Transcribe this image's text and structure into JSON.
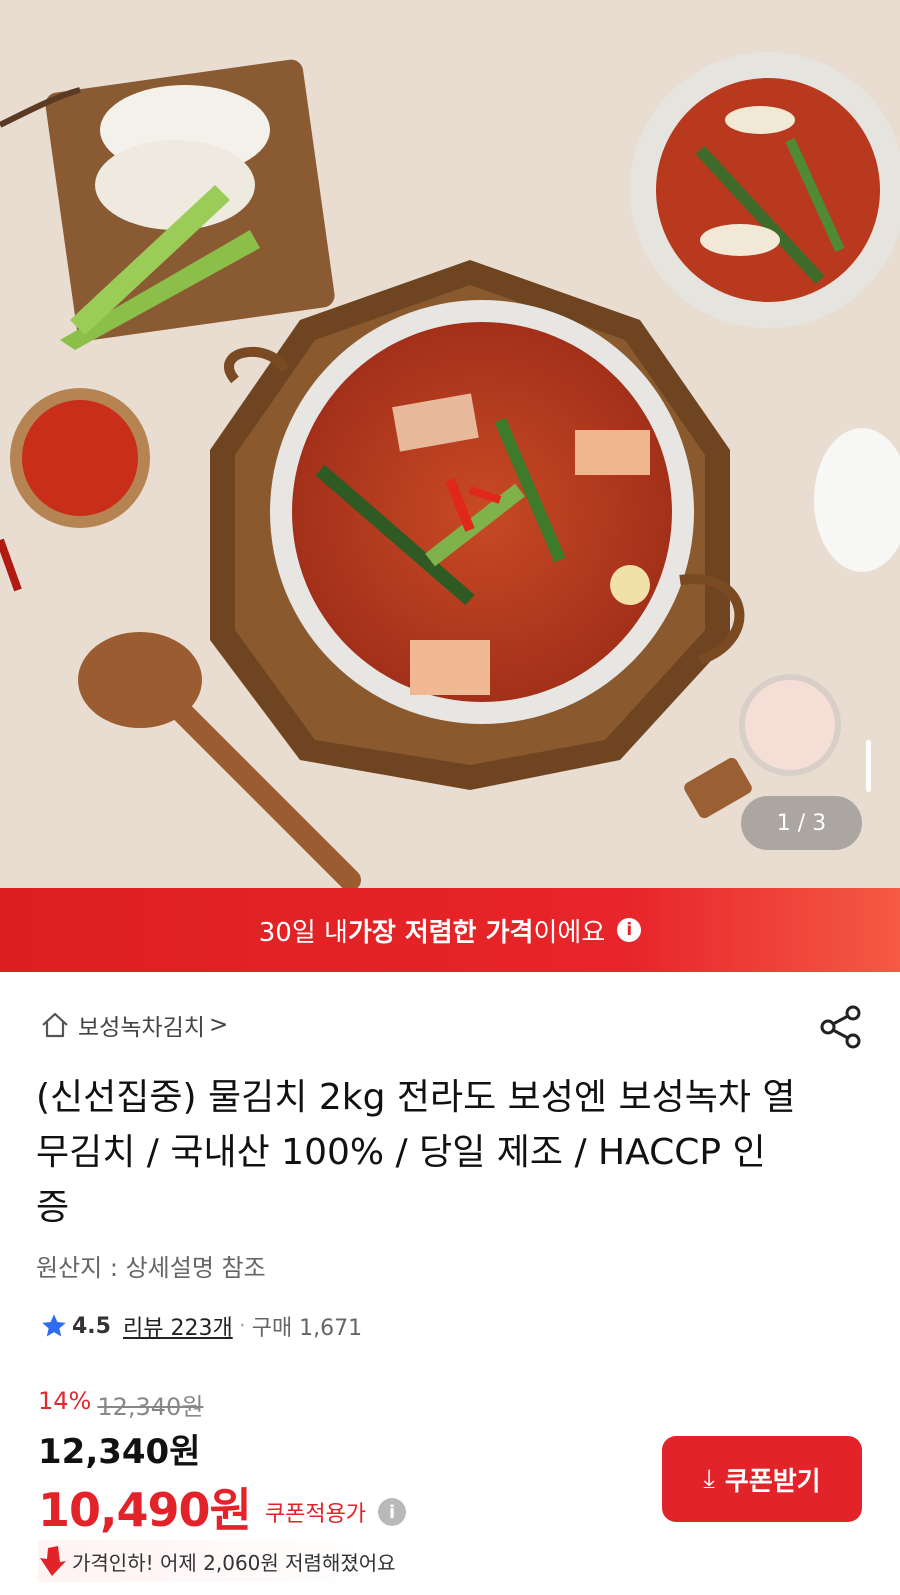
{
  "gallery": {
    "counter": "1 / 3"
  },
  "banner": {
    "prefix": "30일 내 ",
    "highlight": "가장 저렴한 가격",
    "suffix": "이에요",
    "info_icon": "i"
  },
  "product": {
    "store_name": "보성녹차김치",
    "store_chevron": ">",
    "title": "(신선집중) 물김치 2kg 전라도 보성엔 보성녹차 열무김치 / 국내산 100% / 당일 제조 / HACCP 인증",
    "origin": "원산지 : 상세설명 참조",
    "rating": "4.5",
    "reviews": "리뷰 223개",
    "purchases": "구매 1,671"
  },
  "price": {
    "discount_pct": "14%",
    "original": "12,340원",
    "sale": "12,340원",
    "coupon_price": "10,490원",
    "coupon_label": "쿠폰적용가",
    "info_icon": "i",
    "drop_text": "가격인하! 어제 2,060원 저렴해졌어요"
  },
  "coupon_button": {
    "label": "쿠폰받기",
    "icon": "download-arrow"
  },
  "colors": {
    "accent": "#e3232a",
    "star": "#2f6bf0"
  }
}
